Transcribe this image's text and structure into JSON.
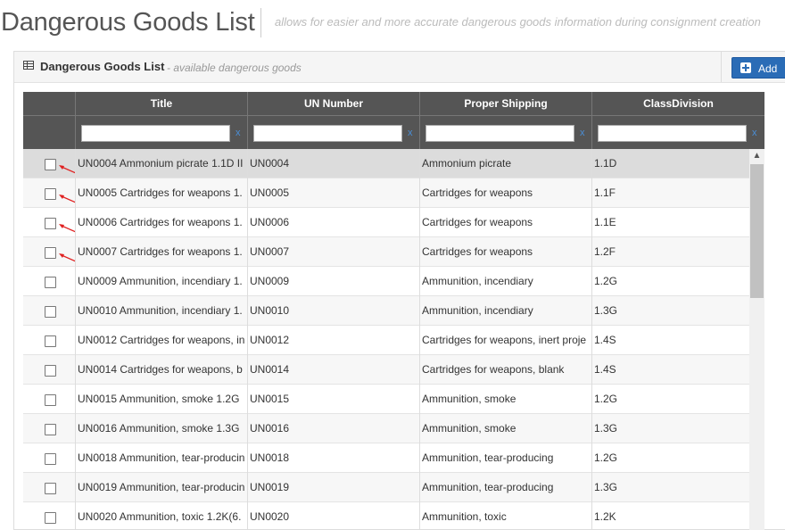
{
  "page": {
    "title": "Dangerous Goods List",
    "subtitle": "allows for easier and more accurate dangerous goods information during consignment creation"
  },
  "panel": {
    "icon": "table-icon",
    "title": "Dangerous Goods List",
    "subtitle": "- available dangerous goods",
    "add_button_label": "Add",
    "add_icon": "plus-square-icon"
  },
  "colors": {
    "accent": "#2a6cb6",
    "grid_header": "#555555",
    "selected_row": "#dcdcdc",
    "annotation_arrow": "#e02020"
  },
  "grid": {
    "columns": [
      "Title",
      "UN Number",
      "Proper Shipping",
      "ClassDivision"
    ],
    "filter_clear": "x",
    "rows": [
      {
        "title": "UN0004 Ammonium picrate 1.1D II",
        "un": "UN0004",
        "shipping": "Ammonium picrate",
        "class": "1.1D"
      },
      {
        "title": "UN0005 Cartridges for weapons 1.",
        "un": "UN0005",
        "shipping": "Cartridges for weapons",
        "class": "1.1F"
      },
      {
        "title": "UN0006 Cartridges for weapons 1.",
        "un": "UN0006",
        "shipping": "Cartridges for weapons",
        "class": "1.1E"
      },
      {
        "title": "UN0007 Cartridges for weapons 1.",
        "un": "UN0007",
        "shipping": "Cartridges for weapons",
        "class": "1.2F"
      },
      {
        "title": "UN0009 Ammunition, incendiary 1.",
        "un": "UN0009",
        "shipping": "Ammunition, incendiary",
        "class": "1.2G"
      },
      {
        "title": "UN0010 Ammunition, incendiary 1.",
        "un": "UN0010",
        "shipping": "Ammunition, incendiary",
        "class": "1.3G"
      },
      {
        "title": "UN0012 Cartridges for weapons, in",
        "un": "UN0012",
        "shipping": "Cartridges for weapons, inert proje",
        "class": "1.4S"
      },
      {
        "title": "UN0014 Cartridges for weapons, b",
        "un": "UN0014",
        "shipping": "Cartridges for weapons, blank",
        "class": "1.4S"
      },
      {
        "title": "UN0015 Ammunition, smoke 1.2G",
        "un": "UN0015",
        "shipping": "Ammunition, smoke",
        "class": "1.2G"
      },
      {
        "title": "UN0016 Ammunition, smoke 1.3G",
        "un": "UN0016",
        "shipping": "Ammunition, smoke",
        "class": "1.3G"
      },
      {
        "title": "UN0018 Ammunition, tear-producin",
        "un": "UN0018",
        "shipping": "Ammunition, tear-producing",
        "class": "1.2G"
      },
      {
        "title": "UN0019 Ammunition, tear-producin",
        "un": "UN0019",
        "shipping": "Ammunition, tear-producing",
        "class": "1.3G"
      },
      {
        "title": "UN0020 Ammunition, toxic 1.2K(6.",
        "un": "UN0020",
        "shipping": "Ammunition, toxic",
        "class": "1.2K"
      }
    ]
  }
}
